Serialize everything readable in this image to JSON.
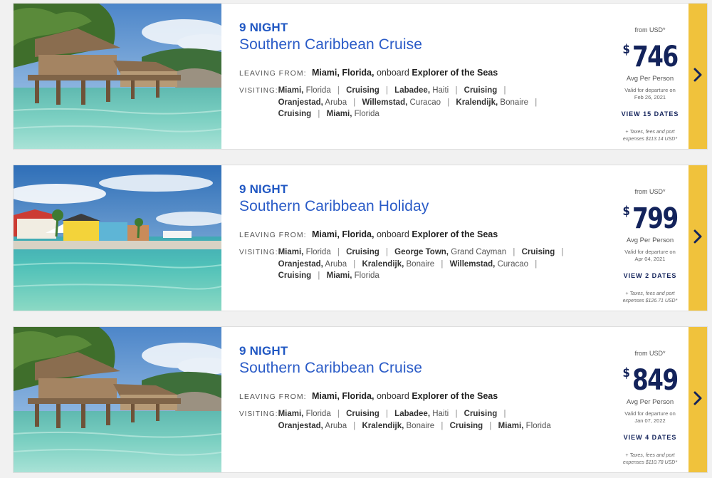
{
  "labels": {
    "leaving": "LEAVING FROM:",
    "visiting": "VISITING:",
    "onboard": "onboard"
  },
  "cards": [
    {
      "nights": "9 NIGHT",
      "title": "Southern Caribbean Cruise",
      "leaving_city": "Miami, Florida,",
      "ship": "Explorer of the Seas",
      "ports": [
        {
          "name": "Miami,",
          "region": "Florida"
        },
        {
          "name": "Cruising",
          "region": ""
        },
        {
          "name": "Labadee,",
          "region": "Haiti"
        },
        {
          "name": "Cruising",
          "region": ""
        },
        {
          "name": "Oranjestad,",
          "region": "Aruba"
        },
        {
          "name": "Willemstad,",
          "region": "Curacao"
        },
        {
          "name": "Kralendijk,",
          "region": "Bonaire"
        },
        {
          "name": "Cruising",
          "region": ""
        },
        {
          "name": "Miami,",
          "region": "Florida"
        }
      ],
      "from_label": "from USD*",
      "currency": "$",
      "price": "746",
      "avg": "Avg Per Person",
      "valid1": "Valid for departure on",
      "valid2": "Feb 26, 2021",
      "view_dates": "VIEW 15 DATES",
      "tax1": "+ Taxes, fees and port",
      "tax2": "expenses $113.14 USD*",
      "photo": "hut"
    },
    {
      "nights": "9 NIGHT",
      "title": "Southern Caribbean Holiday",
      "leaving_city": "Miami, Florida,",
      "ship": "Explorer of the Seas",
      "ports": [
        {
          "name": "Miami,",
          "region": "Florida"
        },
        {
          "name": "Cruising",
          "region": ""
        },
        {
          "name": "George Town,",
          "region": "Grand Cayman"
        },
        {
          "name": "Cruising",
          "region": ""
        },
        {
          "name": "Oranjestad,",
          "region": "Aruba"
        },
        {
          "name": "Kralendijk,",
          "region": "Bonaire"
        },
        {
          "name": "Willemstad,",
          "region": "Curacao"
        },
        {
          "name": "Cruising",
          "region": ""
        },
        {
          "name": "Miami,",
          "region": "Florida"
        }
      ],
      "from_label": "from USD*",
      "currency": "$",
      "price": "799",
      "avg": "Avg Per Person",
      "valid1": "Valid for departure on",
      "valid2": "Apr 04, 2021",
      "view_dates": "VIEW 2 DATES",
      "tax1": "+ Taxes, fees and port",
      "tax2": "expenses $126.71 USD*",
      "photo": "village"
    },
    {
      "nights": "9 NIGHT",
      "title": "Southern Caribbean Cruise",
      "leaving_city": "Miami, Florida,",
      "ship": "Explorer of the Seas",
      "ports": [
        {
          "name": "Miami,",
          "region": "Florida"
        },
        {
          "name": "Cruising",
          "region": ""
        },
        {
          "name": "Labadee,",
          "region": "Haiti"
        },
        {
          "name": "Cruising",
          "region": ""
        },
        {
          "name": "Oranjestad,",
          "region": "Aruba"
        },
        {
          "name": "Kralendijk,",
          "region": "Bonaire"
        },
        {
          "name": "Cruising",
          "region": ""
        },
        {
          "name": "Miami,",
          "region": "Florida"
        }
      ],
      "from_label": "from USD*",
      "currency": "$",
      "price": "849",
      "avg": "Avg Per Person",
      "valid1": "Valid for departure on",
      "valid2": "Jan 07, 2022",
      "view_dates": "VIEW 4 DATES",
      "tax1": "+ Taxes, fees and port",
      "tax2": "expenses $110.78 USD*",
      "photo": "hut"
    }
  ],
  "colors": {
    "accent": "#2158c3",
    "price": "#13235b",
    "arrow_bg": "#f0c23c"
  },
  "icons": {
    "next": "chevron-right-icon"
  }
}
